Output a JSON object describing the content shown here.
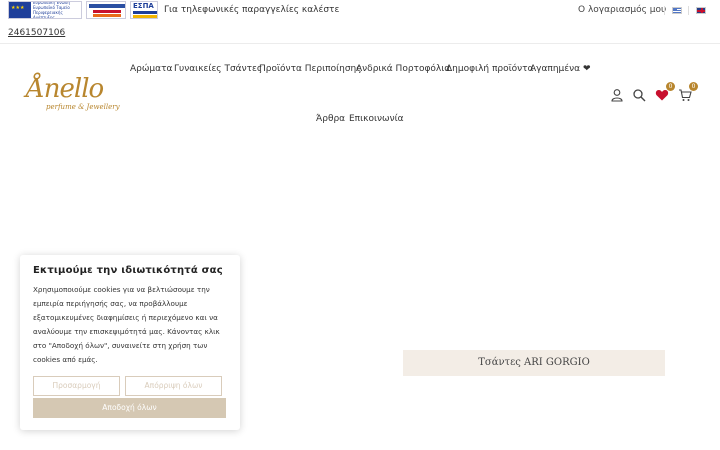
{
  "topbar": {
    "eu_text": "Ευρωπαϊκή Ένωση Ευρωπαϊκό Ταμείο Περιφερειακής Ανάπτυξης",
    "espa_label": "ΕΣΠΑ",
    "phone_prompt": "Για τηλεφωνικές παραγγελίες καλέστε",
    "phone_number": "2461507106",
    "account_label": "Ο λογαριασμός μου",
    "languages": [
      "greek-flag",
      "english-flag"
    ]
  },
  "logo": {
    "main": "Ånello",
    "sub": "perfume & Jewellery"
  },
  "nav": {
    "items": [
      "Αρώματα",
      "Γυναικείες Τσάντες",
      "Προϊόντα Περιποίησης",
      "Ανδρικά Πορτοφόλια",
      "Δημοφιλή προϊόντα",
      "Αγαπημένα ❤"
    ],
    "row2": [
      "Άρθρα",
      "Επικοινωνία"
    ]
  },
  "header_icons": {
    "wishlist_count": "0",
    "cart_count": "0",
    "accent": "#b8862e"
  },
  "cookie": {
    "title": "Εκτιμούμε την ιδιωτικότητά σας",
    "body": "Χρησιμοποιούμε cookies για να βελτιώσουμε την εμπειρία περιήγησής σας, να προβάλλουμε εξατομικευμένες διαφημίσεις ή περιεχόμενο και να αναλύουμε την επισκεψιμότητά μας. Κάνοντας κλικ στο \"Αποδοχή όλων\", συναινείτε στη χρήση των cookies από εμάς.",
    "customize_label": "Προσαρμογή",
    "reject_label": "Απόρριψη όλων",
    "accept_label": "Αποδοχή όλων"
  },
  "product": {
    "banner": "Τσάντες ARI GORGIO"
  }
}
